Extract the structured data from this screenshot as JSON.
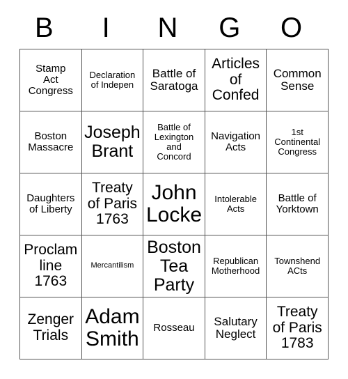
{
  "card": {
    "title_letters": [
      "B",
      "I",
      "N",
      "G",
      "O"
    ],
    "columns": 5,
    "rows": 5,
    "text_color": "#000000",
    "background_color": "#ffffff",
    "border_color": "#555555",
    "cells": [
      [
        {
          "text": "Stamp\nAct\nCongress",
          "size": "m"
        },
        {
          "text": "Declaration\nof Indepen",
          "size": "s"
        },
        {
          "text": "Battle of\nSaratoga",
          "size": "l"
        },
        {
          "text": "Articles\nof\nConfed",
          "size": "xl"
        },
        {
          "text": "Common\nSense",
          "size": "l"
        }
      ],
      [
        {
          "text": "Boston\nMassacre",
          "size": "m"
        },
        {
          "text": "Joseph\nBrant",
          "size": "xxl"
        },
        {
          "text": "Battle of\nLexington\nand\nConcord",
          "size": "s"
        },
        {
          "text": "Navigation\nActs",
          "size": "m"
        },
        {
          "text": "1st\nContinental\nCongress",
          "size": "s"
        }
      ],
      [
        {
          "text": "Daughters\nof Liberty",
          "size": "m"
        },
        {
          "text": "Treaty\nof Paris\n1763",
          "size": "xl"
        },
        {
          "text": "John\nLocke",
          "size": "huge"
        },
        {
          "text": "Intolerable\nActs",
          "size": "s"
        },
        {
          "text": "Battle of\nYorktown",
          "size": "m"
        }
      ],
      [
        {
          "text": "Proclam\nline\n1763",
          "size": "xl"
        },
        {
          "text": "Mercantilism",
          "size": "xs"
        },
        {
          "text": "Boston\nTea\nParty",
          "size": "xxl"
        },
        {
          "text": "Republican\nMotherhood",
          "size": "s"
        },
        {
          "text": "Townshend\nACts",
          "size": "s"
        }
      ],
      [
        {
          "text": "Zenger\nTrials",
          "size": "xl"
        },
        {
          "text": "Adam\nSmith",
          "size": "huge"
        },
        {
          "text": "Rosseau",
          "size": "m"
        },
        {
          "text": "Salutary\nNeglect",
          "size": "l"
        },
        {
          "text": "Treaty\nof Paris\n1783",
          "size": "xl"
        }
      ]
    ]
  }
}
